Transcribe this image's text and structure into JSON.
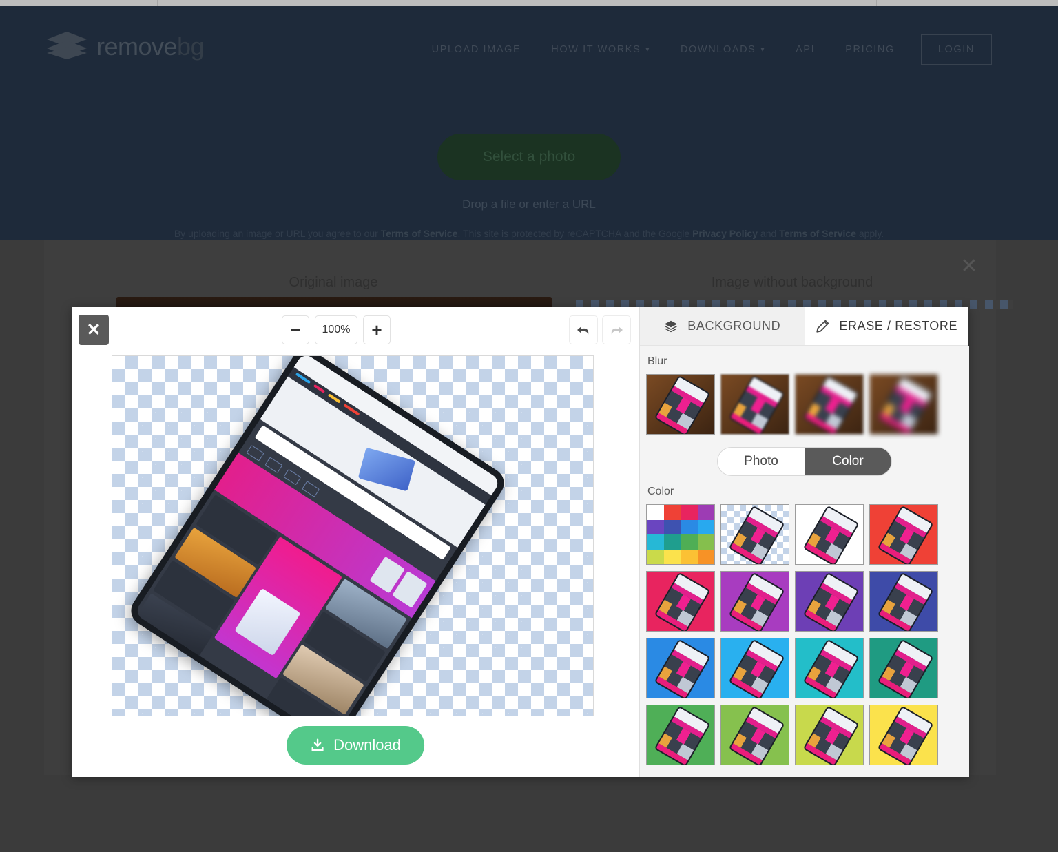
{
  "site": {
    "logo": {
      "part1": "remove",
      "part2": "bg",
      "icon": "layers-icon"
    },
    "nav": [
      {
        "label": "UPLOAD IMAGE",
        "caret": false
      },
      {
        "label": "HOW IT WORKS",
        "caret": true
      },
      {
        "label": "DOWNLOADS",
        "caret": true
      },
      {
        "label": "API",
        "caret": false
      },
      {
        "label": "PRICING",
        "caret": false
      }
    ],
    "login_label": "LOGIN",
    "hero": {
      "select_photo": "Select a photo",
      "drop_prefix": "Drop a file or ",
      "drop_link": "enter a URL",
      "legal_a": "By uploading an image or URL you agree to our ",
      "legal_tos1": "Terms of Service",
      "legal_b": ". This site is protected by reCAPTCHA and the Google ",
      "legal_privacy": "Privacy Policy",
      "legal_c": " and ",
      "legal_tos2": "Terms of Service",
      "legal_d": " apply."
    }
  },
  "result_modal": {
    "close_icon": "close-icon",
    "original_title": "Original image",
    "nobg_title": "Image without background"
  },
  "editor": {
    "close_icon": "close-icon",
    "zoom": {
      "minus": "−",
      "value": "100%",
      "plus": "+"
    },
    "undo_icon": "undo-arrow-icon",
    "redo_icon": "redo-arrow-icon",
    "download_label": "Download",
    "download_icon": "download-icon",
    "tabs": [
      {
        "label": "BACKGROUND",
        "icon": "layers-icon",
        "active": false
      },
      {
        "label": "ERASE / RESTORE",
        "icon": "pencil-icon",
        "active": true
      }
    ],
    "blur": {
      "label": "Blur",
      "options": [
        "none",
        "light",
        "medium",
        "strong"
      ]
    },
    "mode_toggle": {
      "photo": "Photo",
      "color": "Color",
      "selected": "Color"
    },
    "color": {
      "label": "Color",
      "picker_swatches": [
        "#ffffff",
        "#ef4136",
        "#e8245f",
        "#9d3cb4",
        "#6a45c0",
        "#3e52b0",
        "#2a8ae4",
        "#28a9ef",
        "#26b8d6",
        "#1f9e8e",
        "#4fae55",
        "#85bf4d",
        "#cada4a",
        "#fbe24c",
        "#fbc134",
        "#f79226"
      ],
      "thumbnails": [
        "transparent",
        "#ffffff",
        "#ef4136",
        "#e8245f",
        "#a83cc0",
        "#6d3fb5",
        "#3e4ba8",
        "#2a8ae4",
        "#29b0ef",
        "#23bec9",
        "#1f9b82",
        "#4faf57",
        "#86c14e",
        "#c8d94c",
        "#fbe24c"
      ]
    }
  }
}
